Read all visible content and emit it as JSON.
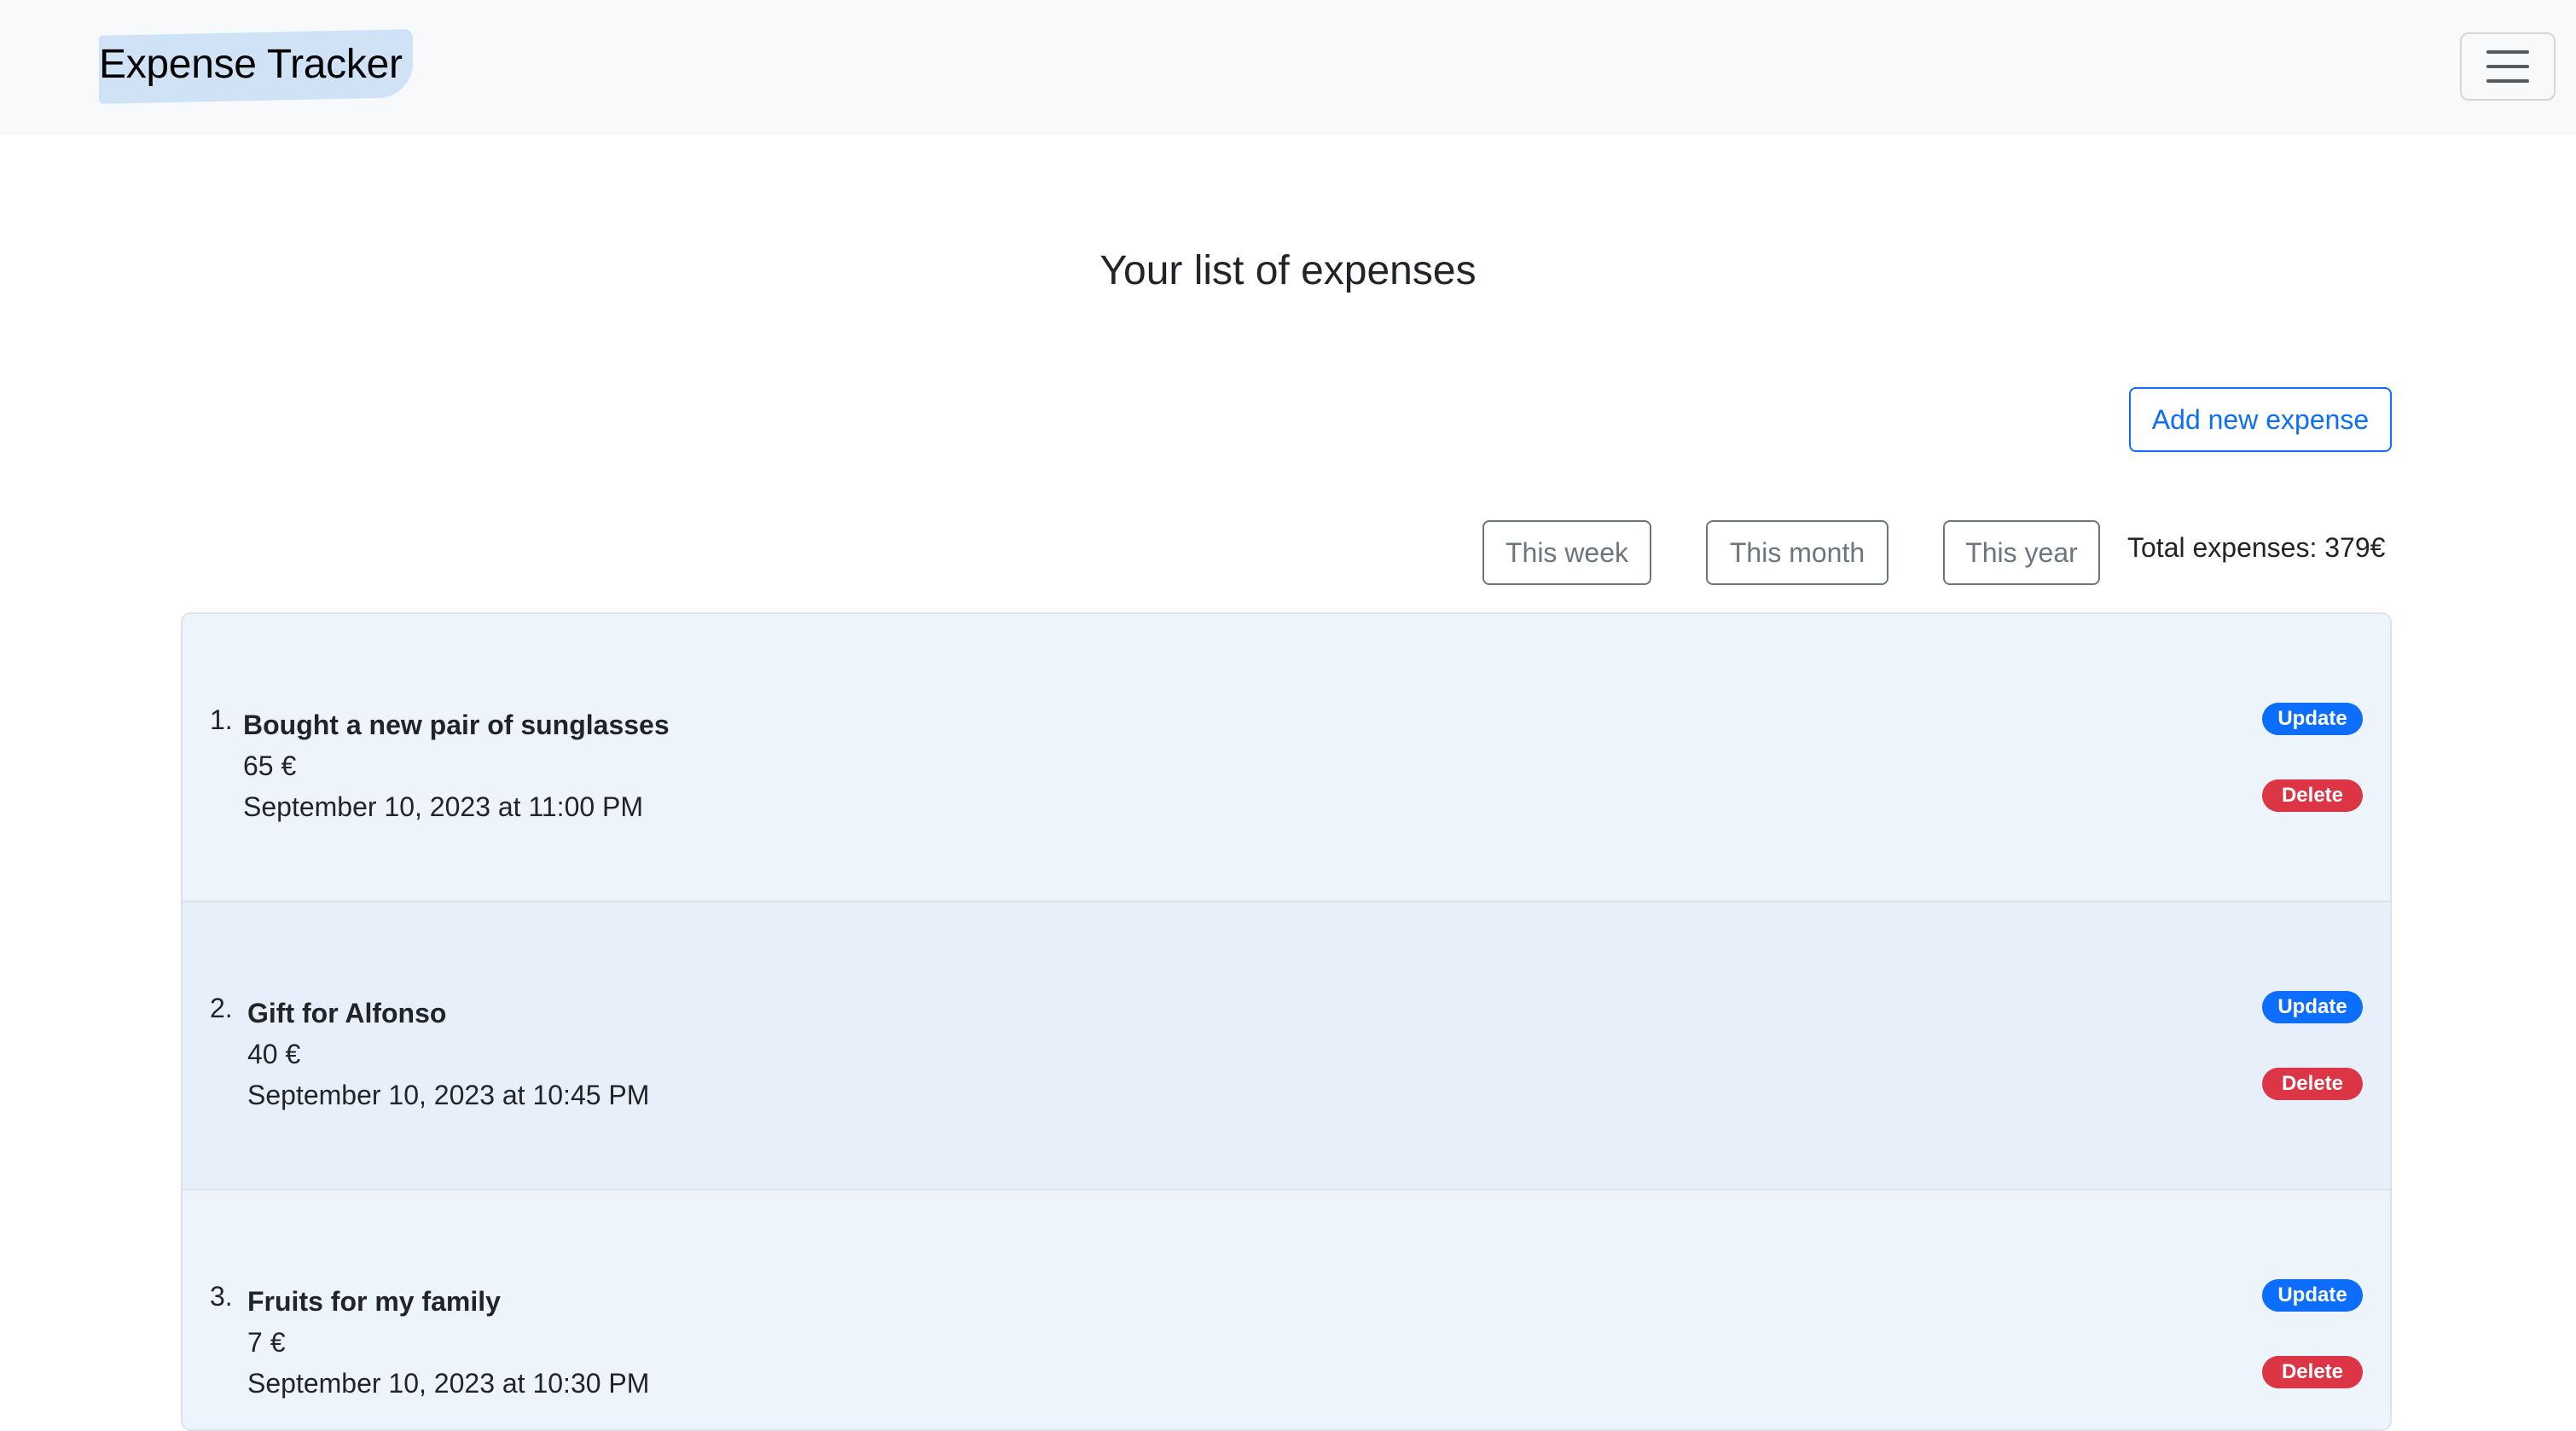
{
  "navbar": {
    "brand": "Expense Tracker"
  },
  "page": {
    "title": "Your list of expenses",
    "add_button": "Add new expense"
  },
  "filters": {
    "week": "This week",
    "month": "This month",
    "year": "This year"
  },
  "total": {
    "label": "Total expenses: 379€"
  },
  "expenses": [
    {
      "num": "1.",
      "title": "Bought a new pair of sunglasses",
      "amount": "65 €",
      "date": "September 10, 2023 at 11:00 PM",
      "update_label": "Update",
      "delete_label": "Delete"
    },
    {
      "num": "2.",
      "title": "Gift for Alfonso",
      "amount": "40 €",
      "date": "September 10, 2023 at 10:45 PM",
      "update_label": "Update",
      "delete_label": "Delete"
    },
    {
      "num": "3.",
      "title": "Fruits for my family",
      "amount": "7 €",
      "date": "September 10, 2023 at 10:30 PM",
      "update_label": "Update",
      "delete_label": "Delete"
    }
  ],
  "colors": {
    "primary": "#0d6efd",
    "danger": "#dc3545",
    "secondary": "#6c757d",
    "navbar_bg": "#f8f9fa",
    "brand_highlight": "#cfe2f6"
  },
  "icons": {
    "menu": "hamburger-menu-icon"
  }
}
